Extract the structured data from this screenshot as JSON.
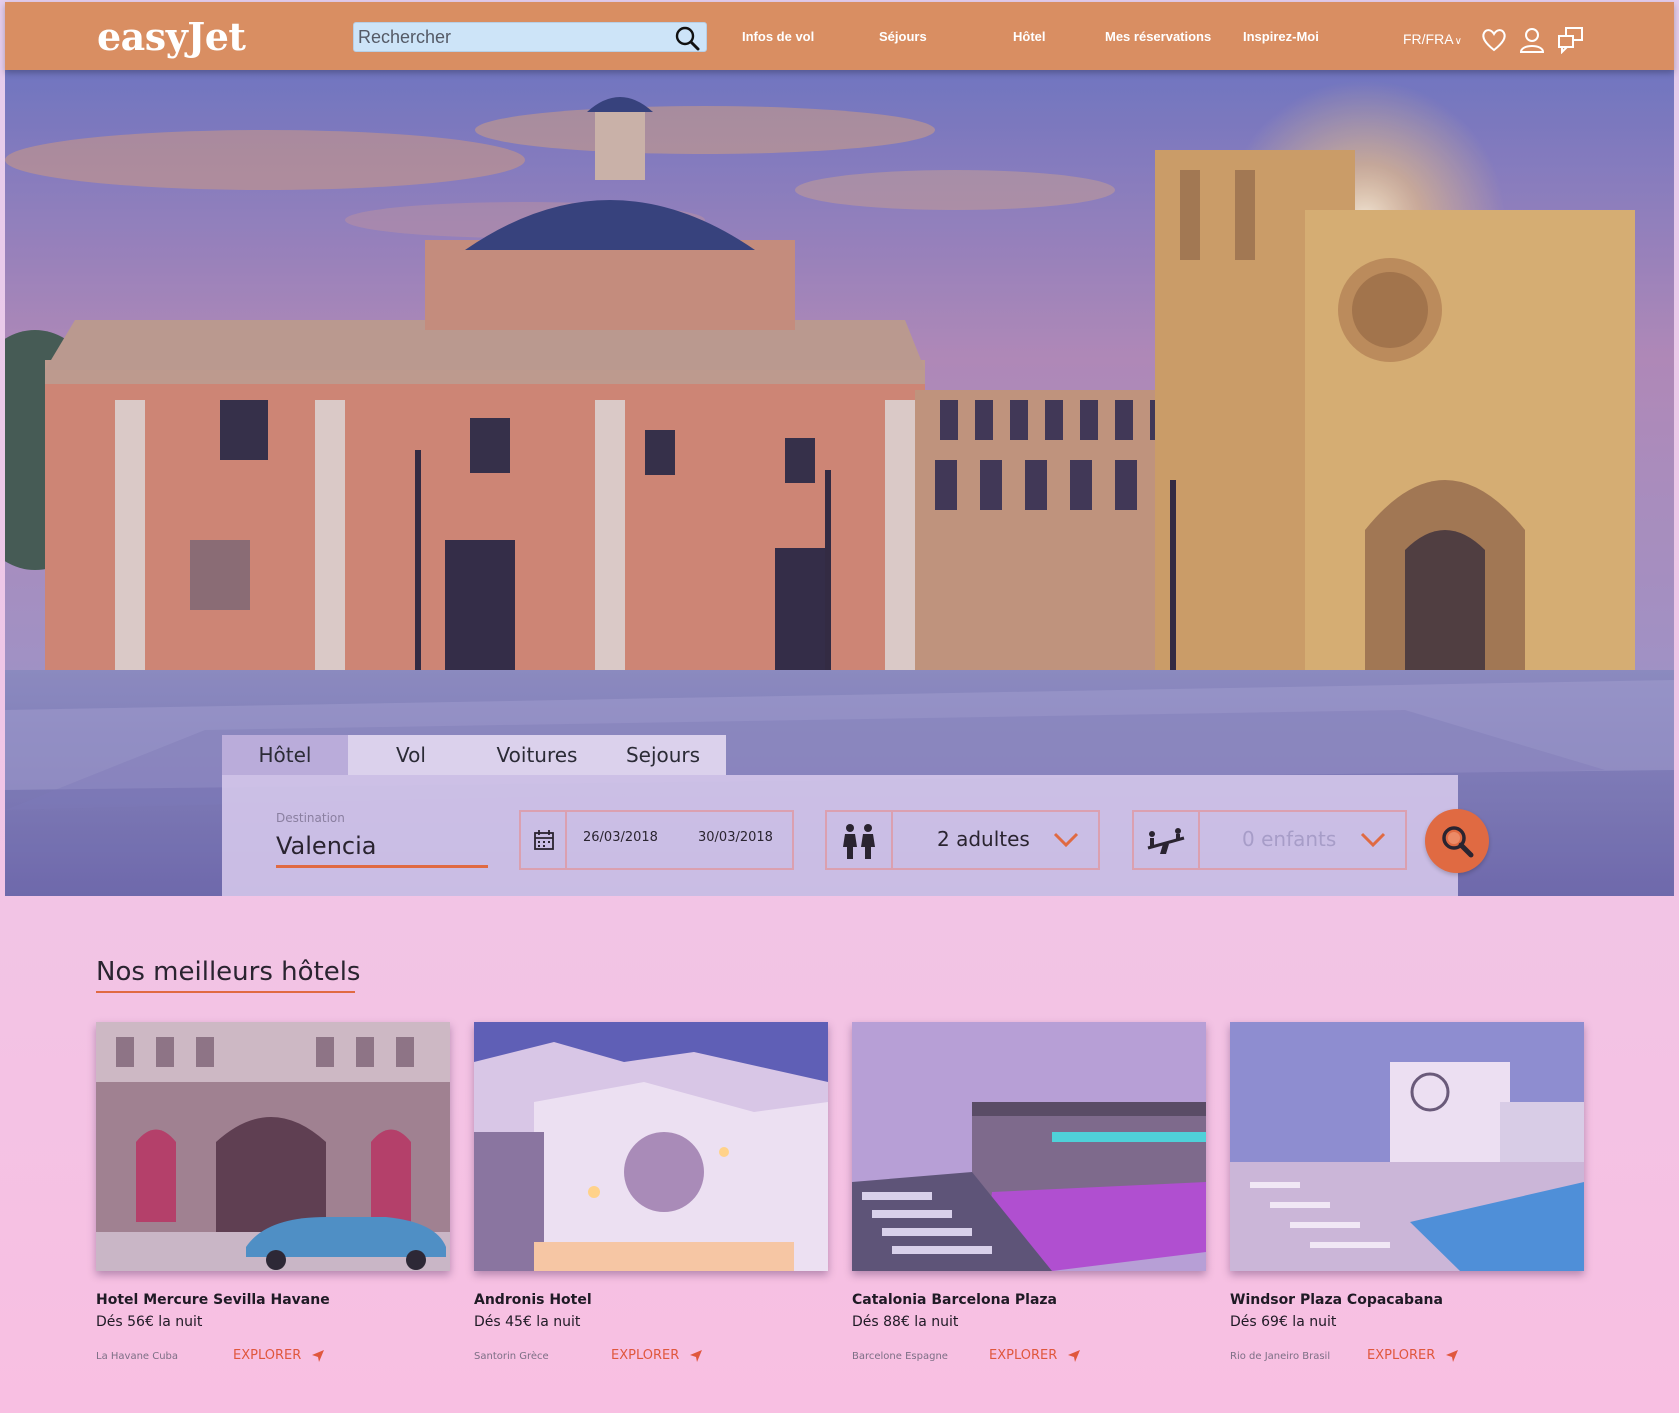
{
  "header": {
    "logo": "easyJet",
    "search_placeholder": "Rechercher",
    "nav": [
      "Infos de vol",
      "Séjours",
      "Hôtel",
      "Mes réservations",
      "Inspirez-Moi"
    ],
    "language": "FR/FRA",
    "icons": [
      "heart-icon",
      "user-icon",
      "chat-icon"
    ]
  },
  "booking": {
    "tabs": [
      "Hôtel",
      "Vol",
      "Voitures",
      "Sejours"
    ],
    "active_tab": "Hôtel",
    "destination_label": "Destination",
    "destination_value": "Valencia",
    "date_from": "26/03/2018",
    "date_to": "30/03/2018",
    "adults": "2 adultes",
    "children": "0 enfants"
  },
  "hotels": {
    "title": "Nos meilleurs hôtels",
    "items": [
      {
        "name": "Hotel Mercure Sevilla Havane",
        "price": "Dés 56€ la nuit",
        "location": "La Havane Cuba",
        "cta": "EXPLORER"
      },
      {
        "name": "Andronis Hotel",
        "price": "Dés 45€ la nuit",
        "location": "Santorin Grèce",
        "cta": "EXPLORER"
      },
      {
        "name": "Catalonia Barcelona Plaza",
        "price": "Dés 88€ la nuit",
        "location": "Barcelone Espagne",
        "cta": "EXPLORER"
      },
      {
        "name": "Windsor Plaza Copacabana",
        "price": "Dés 69€ la nuit",
        "location": "Rio de Janeiro Brasil",
        "cta": "EXPLORER"
      }
    ]
  },
  "colors": {
    "header": "#d98e62",
    "accent": "#e06a42",
    "explore": "#e0573d"
  }
}
